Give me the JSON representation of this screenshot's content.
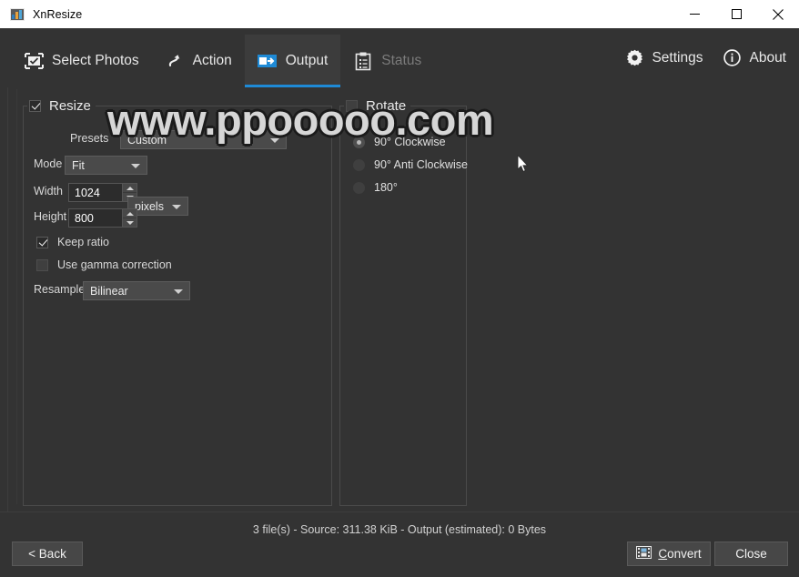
{
  "window": {
    "title": "XnResize",
    "icon": "app-icon",
    "minimize_label": "Minimize",
    "maximize_label": "Maximize",
    "close_label": "Close"
  },
  "toolbar": {
    "tabs": [
      {
        "label": "Select Photos",
        "icon": "checked-photo-icon",
        "state": "enabled"
      },
      {
        "label": "Action",
        "icon": "rotate-arrow-icon",
        "state": "enabled"
      },
      {
        "label": "Output",
        "icon": "output-arrow-icon",
        "state": "active"
      },
      {
        "label": "Status",
        "icon": "clipboard-icon",
        "state": "disabled"
      }
    ],
    "right_items": [
      {
        "label": "Settings",
        "icon": "gear-icon"
      },
      {
        "label": "About",
        "icon": "info-icon"
      }
    ],
    "accent_color": "#1e8ad6",
    "active_tab_bg": "#3c3c3c"
  },
  "resize_panel": {
    "title": "Resize",
    "enabled": true,
    "presets": {
      "label": "Presets",
      "value": "Custom"
    },
    "mode": {
      "label": "Mode",
      "value": "Fit"
    },
    "width": {
      "label": "Width",
      "value": "1024"
    },
    "height": {
      "label": "Height",
      "value": "800"
    },
    "unit": {
      "value": "pixels"
    },
    "keep_ratio": {
      "label": "Keep ratio",
      "checked": true
    },
    "use_gamma": {
      "label": "Use gamma correction",
      "checked": false
    },
    "resample": {
      "label": "Resample",
      "value": "Bilinear"
    }
  },
  "rotate_panel": {
    "title": "Rotate",
    "enabled": false,
    "options": [
      {
        "label": "90° Clockwise",
        "selected": true
      },
      {
        "label": "90° Anti Clockwise",
        "selected": false
      },
      {
        "label": "180°",
        "selected": false
      }
    ]
  },
  "status": {
    "text": "3 file(s) - Source: 311.38 KiB - Output (estimated): 0 Bytes"
  },
  "footer": {
    "back_label": "< Back",
    "convert_mnemonic": "C",
    "convert_label": "onvert",
    "convert_icon": "image-convert-icon",
    "close_label": "Close"
  },
  "watermark": {
    "text": "www.ppooooo.com"
  }
}
